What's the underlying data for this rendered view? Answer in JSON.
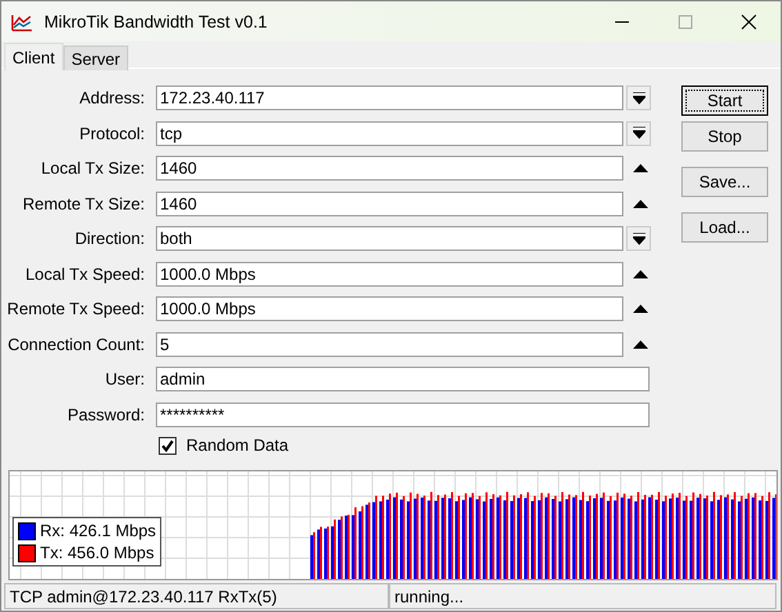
{
  "window": {
    "title": "MikroTik Bandwidth Test v0.1"
  },
  "tabs": [
    {
      "label": "Client",
      "selected": true
    },
    {
      "label": "Server",
      "selected": false
    }
  ],
  "fields": [
    {
      "label": "Address:",
      "value": "172.23.40.117",
      "kind": "dropdown"
    },
    {
      "label": "Protocol:",
      "value": "tcp",
      "kind": "dropdown"
    },
    {
      "label": "Local Tx Size:",
      "value": "1460",
      "kind": "spinner"
    },
    {
      "label": "Remote Tx Size:",
      "value": "1460",
      "kind": "spinner"
    },
    {
      "label": "Direction:",
      "value": "both",
      "kind": "dropdown"
    },
    {
      "label": "Local Tx Speed:",
      "value": "1000.0 Mbps",
      "kind": "spinner"
    },
    {
      "label": "Remote Tx Speed:",
      "value": "1000.0 Mbps",
      "kind": "spinner"
    },
    {
      "label": "Connection Count:",
      "value": "5",
      "kind": "spinner"
    },
    {
      "label": "User:",
      "value": "admin",
      "kind": "text"
    },
    {
      "label": "Password:",
      "value": "**********",
      "kind": "text"
    }
  ],
  "random_data": {
    "label": "Random Data",
    "checked": true
  },
  "buttons": [
    "Start",
    "Stop",
    "Save...",
    "Load..."
  ],
  "legend": [
    {
      "label": "Rx: 426.1 Mbps",
      "color": "#0000ff"
    },
    {
      "label": "Tx: 456.0 Mbps",
      "color": "#ff0000"
    }
  ],
  "status_bar": [
    "TCP admin@172.23.40.117 RxTx(5)",
    "running..."
  ]
}
